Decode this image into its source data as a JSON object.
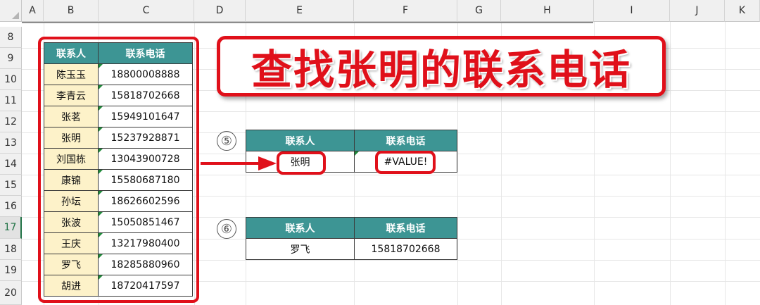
{
  "sheet": {
    "columns": [
      "A",
      "B",
      "C",
      "D",
      "E",
      "F",
      "G",
      "H",
      "I",
      "J",
      "K"
    ],
    "rows": [
      "8",
      "9",
      "10",
      "11",
      "12",
      "13",
      "14",
      "15",
      "16",
      "17",
      "18",
      "19",
      "20"
    ],
    "selected_row": "17"
  },
  "left_table": {
    "headers": [
      "联系人",
      "联系电话"
    ],
    "rows": [
      {
        "name": "陈玉玉",
        "phone": "18800008888"
      },
      {
        "name": "李青云",
        "phone": "15818702668"
      },
      {
        "name": "张茗",
        "phone": "15949101647"
      },
      {
        "name": "张明",
        "phone": "15237928871"
      },
      {
        "name": "刘国栋",
        "phone": "13043900728"
      },
      {
        "name": "康锦",
        "phone": "15580687180"
      },
      {
        "name": "孙坛",
        "phone": "18626602596"
      },
      {
        "name": "张波",
        "phone": "15050851467"
      },
      {
        "name": "王庆",
        "phone": "13217980400"
      },
      {
        "name": "罗飞",
        "phone": "18285880960"
      },
      {
        "name": "胡进",
        "phone": "18720417597"
      }
    ]
  },
  "title": "查找张明的联系电话",
  "example5": {
    "marker": "⑤",
    "headers": [
      "联系人",
      "联系电话"
    ],
    "name": "张明",
    "phone": "#VALUE!"
  },
  "example6": {
    "marker": "⑥",
    "headers": [
      "联系人",
      "联系电话"
    ],
    "name": "罗飞",
    "phone": "15818702668"
  },
  "colors": {
    "header_teal": "#3d9594",
    "name_fill": "#fdf2c9",
    "highlight_red": "#e0101a",
    "excel_green": "#217346"
  }
}
